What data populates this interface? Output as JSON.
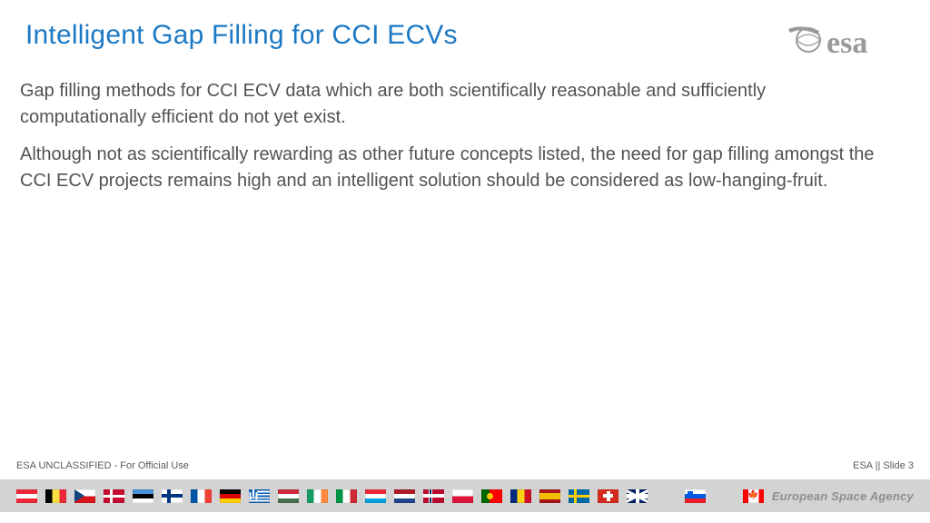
{
  "title": "Intelligent Gap Filling for CCI ECVs",
  "logo_text": "esa",
  "paragraphs": [
    "Gap filling methods for CCI ECV data which are both scientifically reasonable and sufficiently computationally efficient do not yet exist.",
    "Although not as scientifically rewarding as other future concepts listed, the need for gap filling amongst the CCI ECV projects remains high and an intelligent solution should be considered as low-hanging-fruit."
  ],
  "classification": "ESA UNCLASSIFIED - For Official Use",
  "slide_num": "ESA || Slide  3",
  "agency": "European Space Agency",
  "flags": [
    "at",
    "be",
    "cz",
    "dk",
    "ee",
    "fi",
    "fr",
    "de",
    "gr",
    "hu",
    "ie",
    "it",
    "lu",
    "nl",
    "no",
    "pl",
    "pt",
    "ro",
    "es",
    "se",
    "ch",
    "gb",
    "gap",
    "si",
    "gap",
    "ca"
  ]
}
